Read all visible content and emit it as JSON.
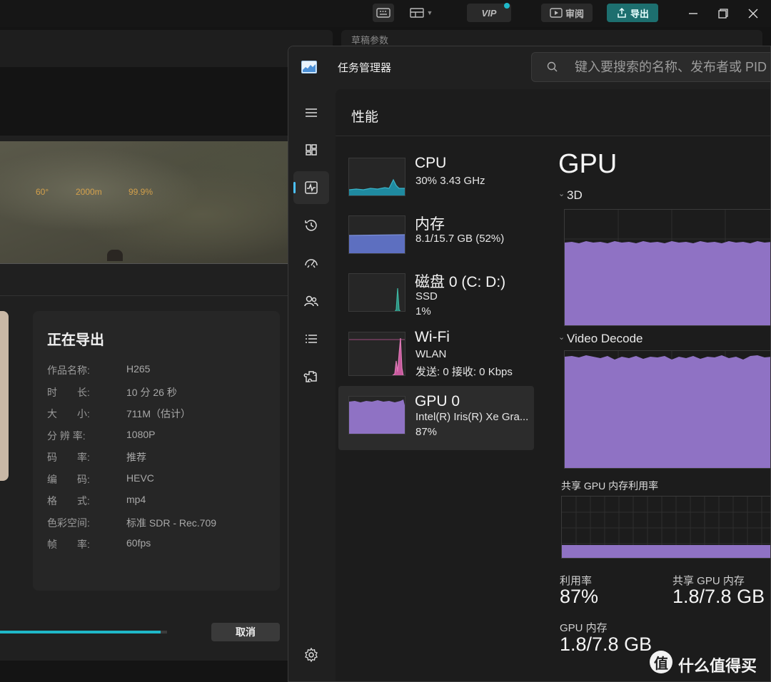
{
  "editor": {
    "topbar": {
      "vip_label": "VIP",
      "review_label": "审阅",
      "export_label": "导出"
    },
    "right_panel_label": "草稿参数",
    "export_dialog": {
      "title": "正在导出",
      "rows": [
        {
          "key": "作品名称:",
          "value": "H265"
        },
        {
          "key": "时　　长:",
          "value": "10 分 26 秒"
        },
        {
          "key": "大　　小:",
          "value": "711M（估计）"
        },
        {
          "key": "分 辨 率:",
          "value": "1080P"
        },
        {
          "key": "码　　率:",
          "value": "推荐"
        },
        {
          "key": "编　　码:",
          "value": "HEVC"
        },
        {
          "key": "格　　式:",
          "value": "mp4"
        },
        {
          "key": "色彩空间:",
          "value": "标准 SDR - Rec.709"
        },
        {
          "key": "帧　　率:",
          "value": "60fps"
        }
      ],
      "progress": 0.96,
      "cancel_label": "取消"
    }
  },
  "taskmgr": {
    "title": "任务管理器",
    "search_placeholder": "键入要搜索的名称、发布者或 PID",
    "section_title": "性能",
    "accent_color": "#4cc2ff",
    "resources": [
      {
        "name": "CPU",
        "line1": "30%  3.43 GHz",
        "line2": "",
        "color": "#3ab4c8",
        "fill": "#1f8aa0"
      },
      {
        "name": "内存",
        "line1": "8.1/15.7 GB (52%)",
        "line2": "",
        "color": "#7b8fd6",
        "fill": "#5d6fc0"
      },
      {
        "name": "磁盘 0 (C: D:)",
        "line1": "SSD",
        "line2": "1%",
        "color": "#3fb5a0",
        "fill": "#2c8f80"
      },
      {
        "name": "Wi-Fi",
        "line1": "WLAN",
        "line2": "发送: 0 接收: 0 Kbps",
        "color": "#e07bb8",
        "fill": "#c85a9e"
      },
      {
        "name": "GPU 0",
        "line1": "Intel(R) Iris(R) Xe Gra...",
        "line2": "87%",
        "color": "#a98bd1",
        "fill": "#8f72c4"
      }
    ],
    "gpu": {
      "title": "GPU",
      "engine1": "3D",
      "engine2": "Video Decode",
      "shared_mem_label": "共享 GPU 内存利用率",
      "util_label": "利用率",
      "util_value": "87%",
      "shared_label": "共享 GPU 内存",
      "shared_value": "1.8/7.8 GB",
      "gpu_mem_label": "GPU 内存",
      "gpu_mem_value": "1.8/7.8 GB",
      "graph_color": "#8f72c4"
    }
  },
  "watermark": {
    "logo_char": "值",
    "text": "什么值得买"
  }
}
